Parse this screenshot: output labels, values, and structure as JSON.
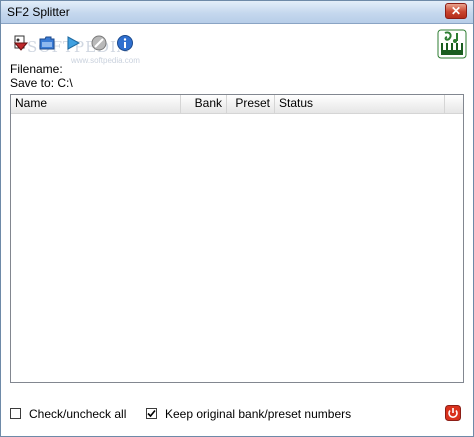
{
  "window": {
    "title": "SF2 Splitter",
    "close_glyph": "✕"
  },
  "toolbar": {
    "buttons": [
      {
        "name": "open-file-icon"
      },
      {
        "name": "folder-icon"
      },
      {
        "name": "play-icon"
      },
      {
        "name": "stop-icon"
      },
      {
        "name": "help-icon"
      }
    ]
  },
  "watermark": {
    "text": "SOFTPEDIA",
    "sub": "www.softpedia.com"
  },
  "info": {
    "filename_label": "Filename:",
    "saveto_label": "Save to:",
    "saveto_value": "C:\\"
  },
  "list": {
    "columns": [
      "Name",
      "Bank",
      "Preset",
      "Status"
    ],
    "rows": []
  },
  "options": {
    "check_all_label": "Check/uncheck all",
    "check_all_checked": false,
    "keep_numbers_label": "Keep original bank/preset numbers",
    "keep_numbers_checked": true
  },
  "colors": {
    "accent": "#2f6fcf",
    "danger": "#d9321d"
  }
}
